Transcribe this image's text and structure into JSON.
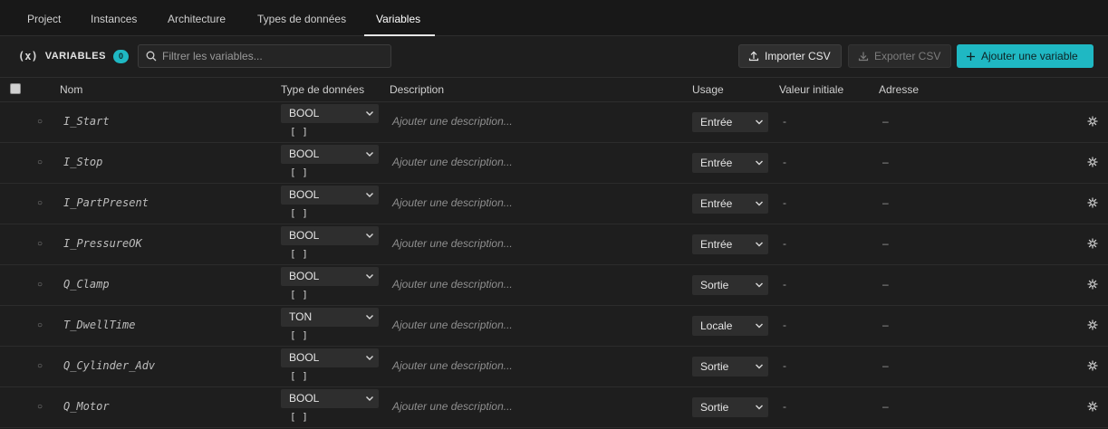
{
  "tabs": [
    {
      "label": "Project"
    },
    {
      "label": "Instances"
    },
    {
      "label": "Architecture"
    },
    {
      "label": "Types de données"
    },
    {
      "label": "Variables",
      "active": true
    }
  ],
  "toolbar": {
    "icon_text": "(x)",
    "title": "VARIABLES",
    "count": "0",
    "search_placeholder": "Filtrer les variables...",
    "import_label": "Importer CSV",
    "export_label": "Exporter CSV",
    "add_label": "Ajouter une variable"
  },
  "table": {
    "headers": {
      "name": "Nom",
      "type": "Type de données",
      "description": "Description",
      "usage": "Usage",
      "initial": "Valeur initiale",
      "address": "Adresse"
    },
    "rows": [
      {
        "name": "I_Start",
        "type": "BOOL",
        "array": "[ ]",
        "description_placeholder": "Ajouter une description...",
        "usage": "Entrée",
        "initial": "-",
        "address": "–"
      },
      {
        "name": "I_Stop",
        "type": "BOOL",
        "array": "[ ]",
        "description_placeholder": "Ajouter une description...",
        "usage": "Entrée",
        "initial": "-",
        "address": "–"
      },
      {
        "name": "I_PartPresent",
        "type": "BOOL",
        "array": "[ ]",
        "description_placeholder": "Ajouter une description...",
        "usage": "Entrée",
        "initial": "-",
        "address": "–"
      },
      {
        "name": "I_PressureOK",
        "type": "BOOL",
        "array": "[ ]",
        "description_placeholder": "Ajouter une description...",
        "usage": "Entrée",
        "initial": "-",
        "address": "–"
      },
      {
        "name": "Q_Clamp",
        "type": "BOOL",
        "array": "[ ]",
        "description_placeholder": "Ajouter une description...",
        "usage": "Sortie",
        "initial": "-",
        "address": "–"
      },
      {
        "name": "T_DwellTime",
        "type": "TON",
        "array": "[ ]",
        "description_placeholder": "Ajouter une description...",
        "usage": "Locale",
        "initial": "-",
        "address": "–"
      },
      {
        "name": "Q_Cylinder_Adv",
        "type": "BOOL",
        "array": "[ ]",
        "description_placeholder": "Ajouter une description...",
        "usage": "Sortie",
        "initial": "-",
        "address": "–"
      },
      {
        "name": "Q_Motor",
        "type": "BOOL",
        "array": "[ ]",
        "description_placeholder": "Ajouter une description...",
        "usage": "Sortie",
        "initial": "-",
        "address": "–"
      }
    ]
  },
  "colors": {
    "accent": "#1fb8c3",
    "background": "#1e1e1e",
    "tabbar": "#181818"
  },
  "icons": {
    "search": "search-icon",
    "import": "upload-icon",
    "export": "download-icon",
    "add": "plus-icon",
    "row_drag": "drag-handle-icon",
    "row_settings": "settings-icon",
    "chevron": "chevron-down-icon"
  }
}
